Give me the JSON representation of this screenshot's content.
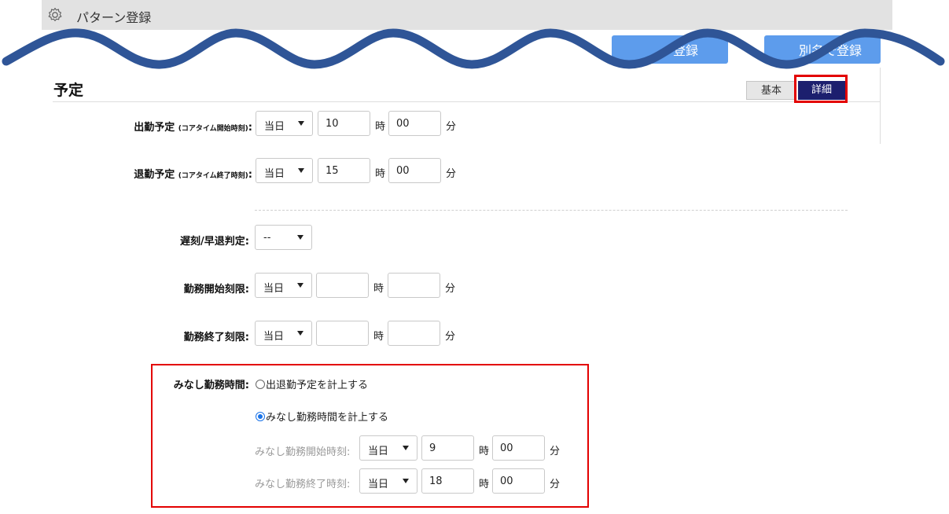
{
  "titlebar": {
    "icon": "gear-icon",
    "title": "パターン登録"
  },
  "header_buttons": {
    "register": "登録",
    "alt_register": "別名で登録"
  },
  "section": {
    "title": "予定"
  },
  "tabs": {
    "basic": "基本",
    "detail": "詳細",
    "active": "詳細"
  },
  "units": {
    "hour": "時",
    "minute": "分"
  },
  "rows": {
    "start_plan": {
      "label": "出勤予定",
      "sublabel": "(コアタイム開始時刻)",
      "colon": ":",
      "day": "当日",
      "hour": "10",
      "minute": "00"
    },
    "end_plan": {
      "label": "退勤予定",
      "sublabel": "(コアタイム終了時刻)",
      "colon": ":",
      "day": "当日",
      "hour": "15",
      "minute": "00"
    },
    "late_judge": {
      "label": "遅刻/早退判定:",
      "value": "--"
    },
    "work_start_limit": {
      "label": "勤務開始刻限:",
      "day": "当日",
      "hour": "",
      "minute": ""
    },
    "work_end_limit": {
      "label": "勤務終了刻限:",
      "day": "当日",
      "hour": "",
      "minute": ""
    }
  },
  "deemed": {
    "label": "みなし勤務時間:",
    "option1": "出退勤予定を計上する",
    "option2": "みなし勤務時間を計上する",
    "selected": "option2",
    "start": {
      "label": "みなし勤務開始時刻:",
      "day": "当日",
      "hour": "9",
      "minute": "00"
    },
    "end": {
      "label": "みなし勤務終了時刻:",
      "day": "当日",
      "hour": "18",
      "minute": "00"
    }
  },
  "colors": {
    "accent": "#1c1f6e",
    "button": "#5d9cec",
    "highlight": "#e30000",
    "wave": "#2f5597"
  }
}
